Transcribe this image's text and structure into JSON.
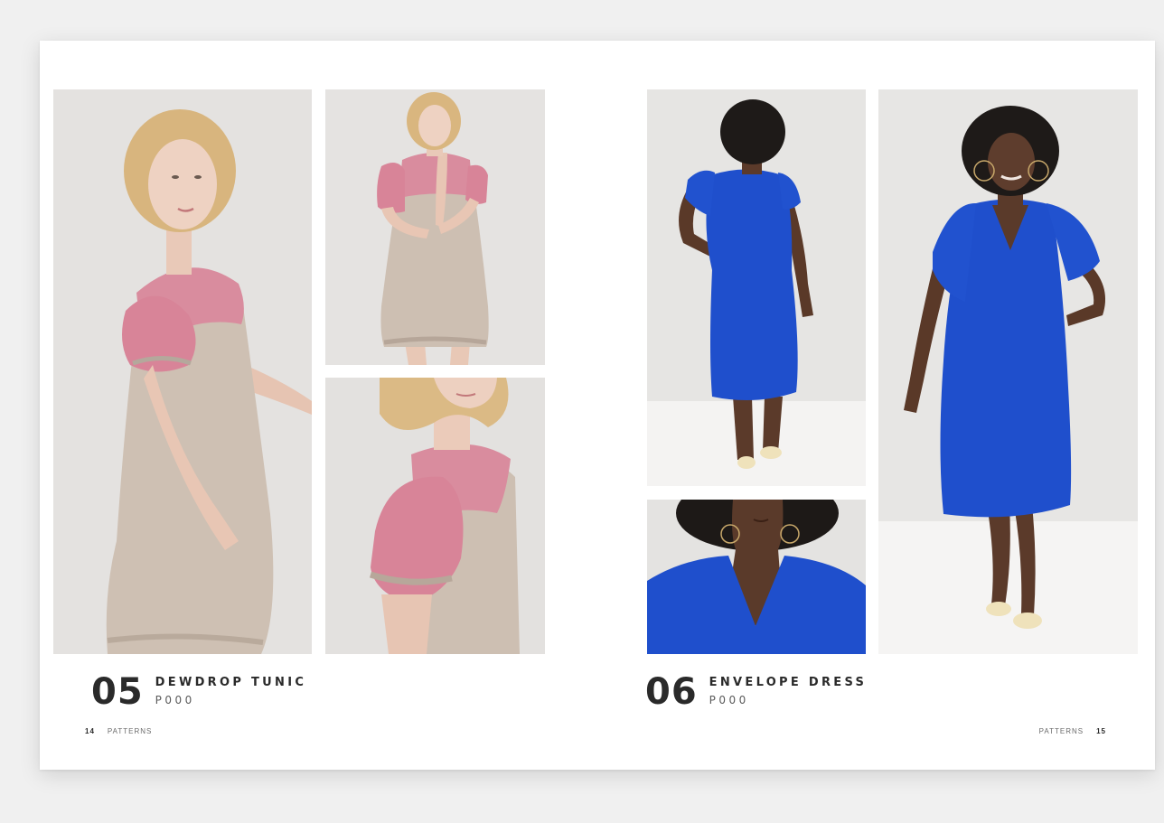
{
  "left_page": {
    "pattern_number": "05",
    "pattern_name": "DEWDROP TUNIC",
    "pattern_code": "P000",
    "page_number": "14",
    "section_label": "PATTERNS"
  },
  "right_page": {
    "pattern_number": "06",
    "pattern_name": "ENVELOPE DRESS",
    "pattern_code": "P000",
    "page_number": "15",
    "section_label": "PATTERNS"
  },
  "photos": [
    {
      "name": "dewdrop-tunic-side-view-photo",
      "subject": "woman in pink and beige tunic, side view"
    },
    {
      "name": "dewdrop-tunic-front-view-photo",
      "subject": "woman in pink and beige tunic, front view"
    },
    {
      "name": "dewdrop-tunic-sleeve-detail-photo",
      "subject": "gathered sleeve detail"
    },
    {
      "name": "envelope-dress-back-view-photo",
      "subject": "woman in blue dress, back view"
    },
    {
      "name": "envelope-dress-neckline-detail-photo",
      "subject": "v-neckline detail"
    },
    {
      "name": "envelope-dress-front-view-photo",
      "subject": "woman in blue dress, front view"
    }
  ],
  "colors": {
    "tunic_pink": "#d9899c",
    "tunic_beige": "#cdbfb2",
    "dress_blue": "#1f4fcc",
    "studio_backdrop": "#e3e1df",
    "text_dark": "#2a2a2a"
  }
}
